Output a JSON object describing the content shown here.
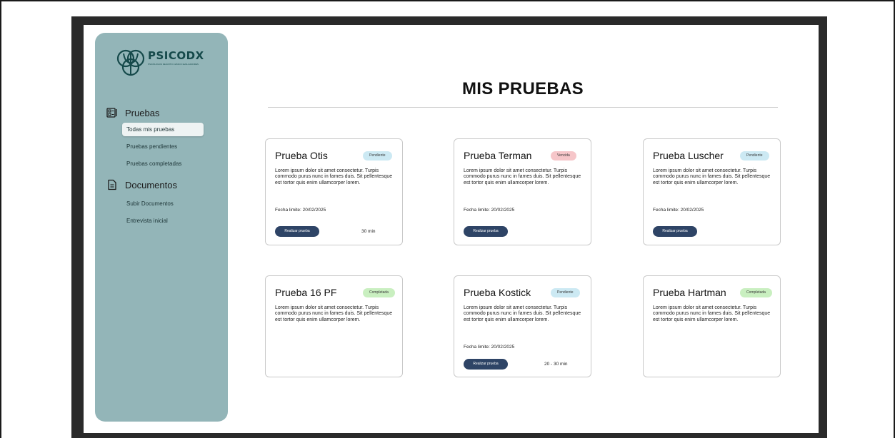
{
  "sidebar": {
    "logo_text": "PSICODX",
    "logo_tagline": "PSICÓLOGOS DE ÉXITO CLÍNICO EVALUADORES",
    "sections": [
      {
        "label": "Pruebas",
        "icon": "tests-icon"
      },
      {
        "label": "Documentos",
        "icon": "document-icon"
      }
    ],
    "pruebas_items": [
      "Todas mis pruebas",
      "Pruebas pendientes",
      "Pruebas completadas"
    ],
    "documentos_items": [
      "Subir Documentos",
      "Entrevista inicial"
    ],
    "active_item": "Todas mis pruebas",
    "color": "#93b5b8"
  },
  "main": {
    "title": "MIS PRUEBAS"
  },
  "badge_colors": {
    "Pendiente": "#cce9f3",
    "Vencida": "#f6c6c9",
    "Completada": "#c9efc0"
  },
  "button_color": "#2e4466",
  "cards": [
    {
      "title": "Prueba Otis",
      "status": "Pendiente",
      "description": "Lorem ipsum dolor sit amet consectetur. Turpis commodo purus nunc in fames duis. Sit pellentesque est tortor quis enim ullamcorper lorem.",
      "date": "Fecha limite: 20/02/2025",
      "button": "Realizar prueba",
      "duration": "30 min"
    },
    {
      "title": "Prueba Terman",
      "status": "Vencida",
      "description": "Lorem ipsum dolor sit amet consectetur. Turpis commodo purus nunc in fames duis. Sit pellentesque est tortor quis enim ullamcorper lorem.",
      "date": "Fecha limite: 20/02/2025",
      "button": "Realizar prueba",
      "duration": ""
    },
    {
      "title": "Prueba Luscher",
      "status": "Pendiente",
      "description": "Lorem ipsum dolor sit amet consectetur. Turpis commodo purus nunc in fames duis. Sit pellentesque est tortor quis enim ullamcorper lorem.",
      "date": "Fecha limite: 20/02/2025",
      "button": "Realizar prueba",
      "duration": ""
    },
    {
      "title": "Prueba 16 PF",
      "status": "Completada",
      "description": "Lorem ipsum dolor sit amet consectetur. Turpis commodo purus nunc in fames duis. Sit pellentesque est tortor quis enim ullamcorper lorem.",
      "date": "",
      "button": "",
      "duration": ""
    },
    {
      "title": "Prueba Kostick",
      "status": "Pendiente",
      "description": "Lorem ipsum dolor sit amet consectetur. Turpis commodo purus nunc in fames duis. Sit pellentesque est tortor quis enim ullamcorper lorem.",
      "date": "Fecha limite: 20/02/2025",
      "button": "Realizar prueba",
      "duration": "20 - 30 min"
    },
    {
      "title": "Prueba Hartman",
      "status": "Completada",
      "description": "Lorem ipsum dolor sit amet consectetur. Turpis commodo purus nunc in fames duis. Sit pellentesque est tortor quis enim ullamcorper lorem.",
      "date": "",
      "button": "",
      "duration": ""
    }
  ]
}
